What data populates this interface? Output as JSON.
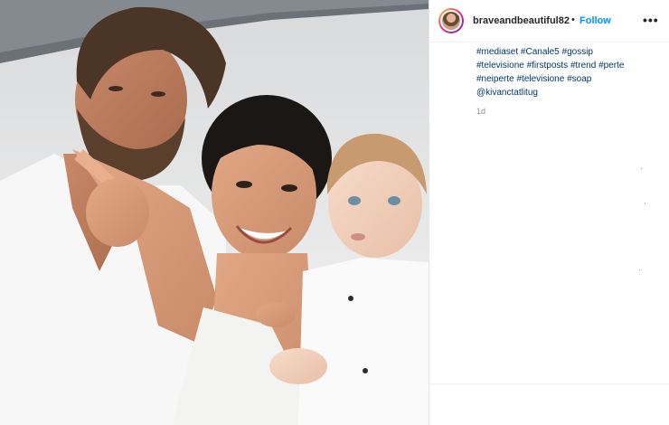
{
  "post": {
    "photo_alt": "",
    "author": {
      "username": "braveandbeautiful82",
      "separator": "•",
      "follow_label": "Follow",
      "more_label": "•••"
    },
    "caption_lines": [
      "#mediaset #Canale5 #gossip",
      "#televisione #firstposts #trend #perte",
      "#neiperte #televisione #soap",
      "@kivanctatlitug"
    ],
    "timestamp": "1d"
  },
  "colors": {
    "link": "#00376b",
    "follow": "#0095f6",
    "text": "#262626",
    "muted": "#8e8e8e"
  }
}
